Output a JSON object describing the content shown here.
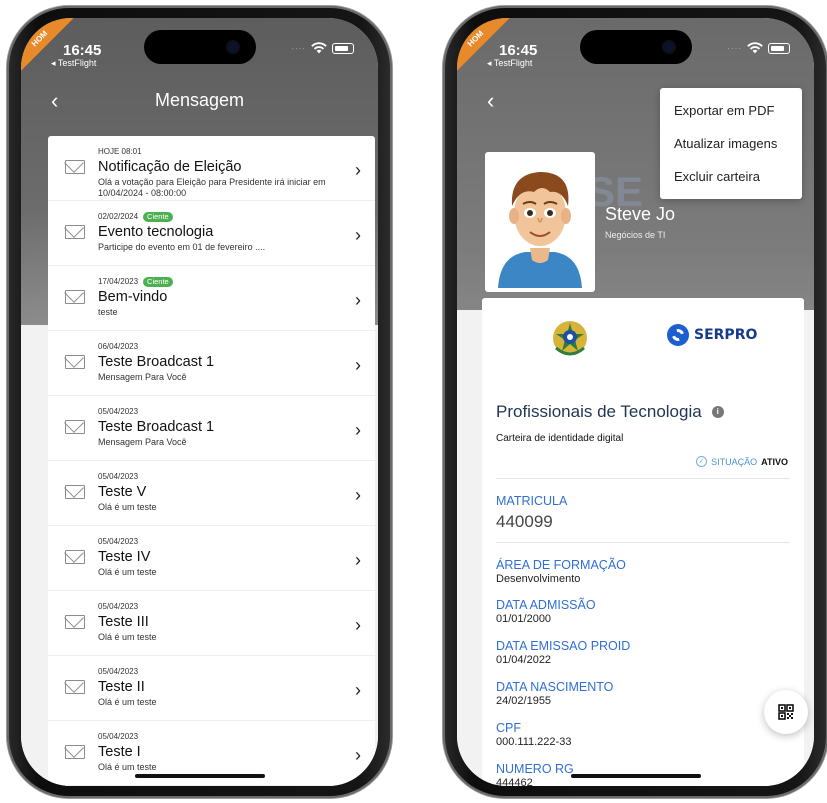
{
  "status": {
    "time": "16:45",
    "app": "TestFlight",
    "ribbon": "HOM"
  },
  "left": {
    "back": "‹",
    "title": "Mensagem",
    "messages": [
      {
        "date": "HOJE 08:01",
        "badge": "",
        "title": "Notificação de Eleição",
        "body": "Olá a votação para Eleição para Presidente irá iniciar em 10/04/2024 - 08:00:00"
      },
      {
        "date": "02/02/2024",
        "badge": "Ciente",
        "title": "Evento tecnologia",
        "body": "Participe do evento em 01 de fevereiro ...."
      },
      {
        "date": "17/04/2023",
        "badge": "Ciente",
        "title": "Bem-vindo",
        "body": "teste"
      },
      {
        "date": "06/04/2023",
        "badge": "",
        "title": "Teste Broadcast 1",
        "body": "Mensagem Para Você"
      },
      {
        "date": "05/04/2023",
        "badge": "",
        "title": "Teste Broadcast 1",
        "body": "Mensagem Para Você"
      },
      {
        "date": "05/04/2023",
        "badge": "",
        "title": "Teste V",
        "body": "Olá é um teste"
      },
      {
        "date": "05/04/2023",
        "badge": "",
        "title": "Teste IV",
        "body": "Olá é um teste"
      },
      {
        "date": "05/04/2023",
        "badge": "",
        "title": "Teste III",
        "body": "Olá é um teste"
      },
      {
        "date": "05/04/2023",
        "badge": "",
        "title": "Teste II",
        "body": "Olá é um teste"
      },
      {
        "date": "05/04/2023",
        "badge": "",
        "title": "Teste I",
        "body": "Olá é um teste"
      }
    ],
    "chevron": "›"
  },
  "right": {
    "back": "‹",
    "menu": [
      "Exportar em PDF",
      "Atualizar imagens",
      "Excluir carteira"
    ],
    "bg_logo": "SE",
    "holder_name": "Steve Jo",
    "holder_role": "Negócios de TI",
    "brand": "SERPRO",
    "card_title": "Profissionais de Tecnologia",
    "info": "i",
    "card_subtitle": "Carteira de identidade digital",
    "situacao_label": "SITUAÇÃO",
    "situacao_value": "ATIVO",
    "matricula_label": "MATRICULA",
    "matricula_value": "440099",
    "fields": [
      {
        "label": "ÁREA DE FORMAÇÃO",
        "value": "Desenvolvimento"
      },
      {
        "label": "DATA ADMISSÃO",
        "value": "01/01/2000"
      },
      {
        "label": "DATA EMISSAO PROID",
        "value": "01/04/2022"
      },
      {
        "label": "DATA NASCIMENTO",
        "value": "24/02/1955"
      },
      {
        "label": "CPF",
        "value": "000.111.222-33"
      },
      {
        "label": "NUMERO RG",
        "value": "444462"
      }
    ]
  },
  "colors": {
    "accent_blue": "#2f6fd6",
    "badge_green": "#4cb050",
    "ribbon_orange": "#e8892a"
  },
  "icons": [
    "back-icon",
    "envelope-icon",
    "chevron-right-icon",
    "wifi-icon",
    "battery-icon",
    "info-icon",
    "check-circle-icon",
    "qr-code-icon"
  ]
}
